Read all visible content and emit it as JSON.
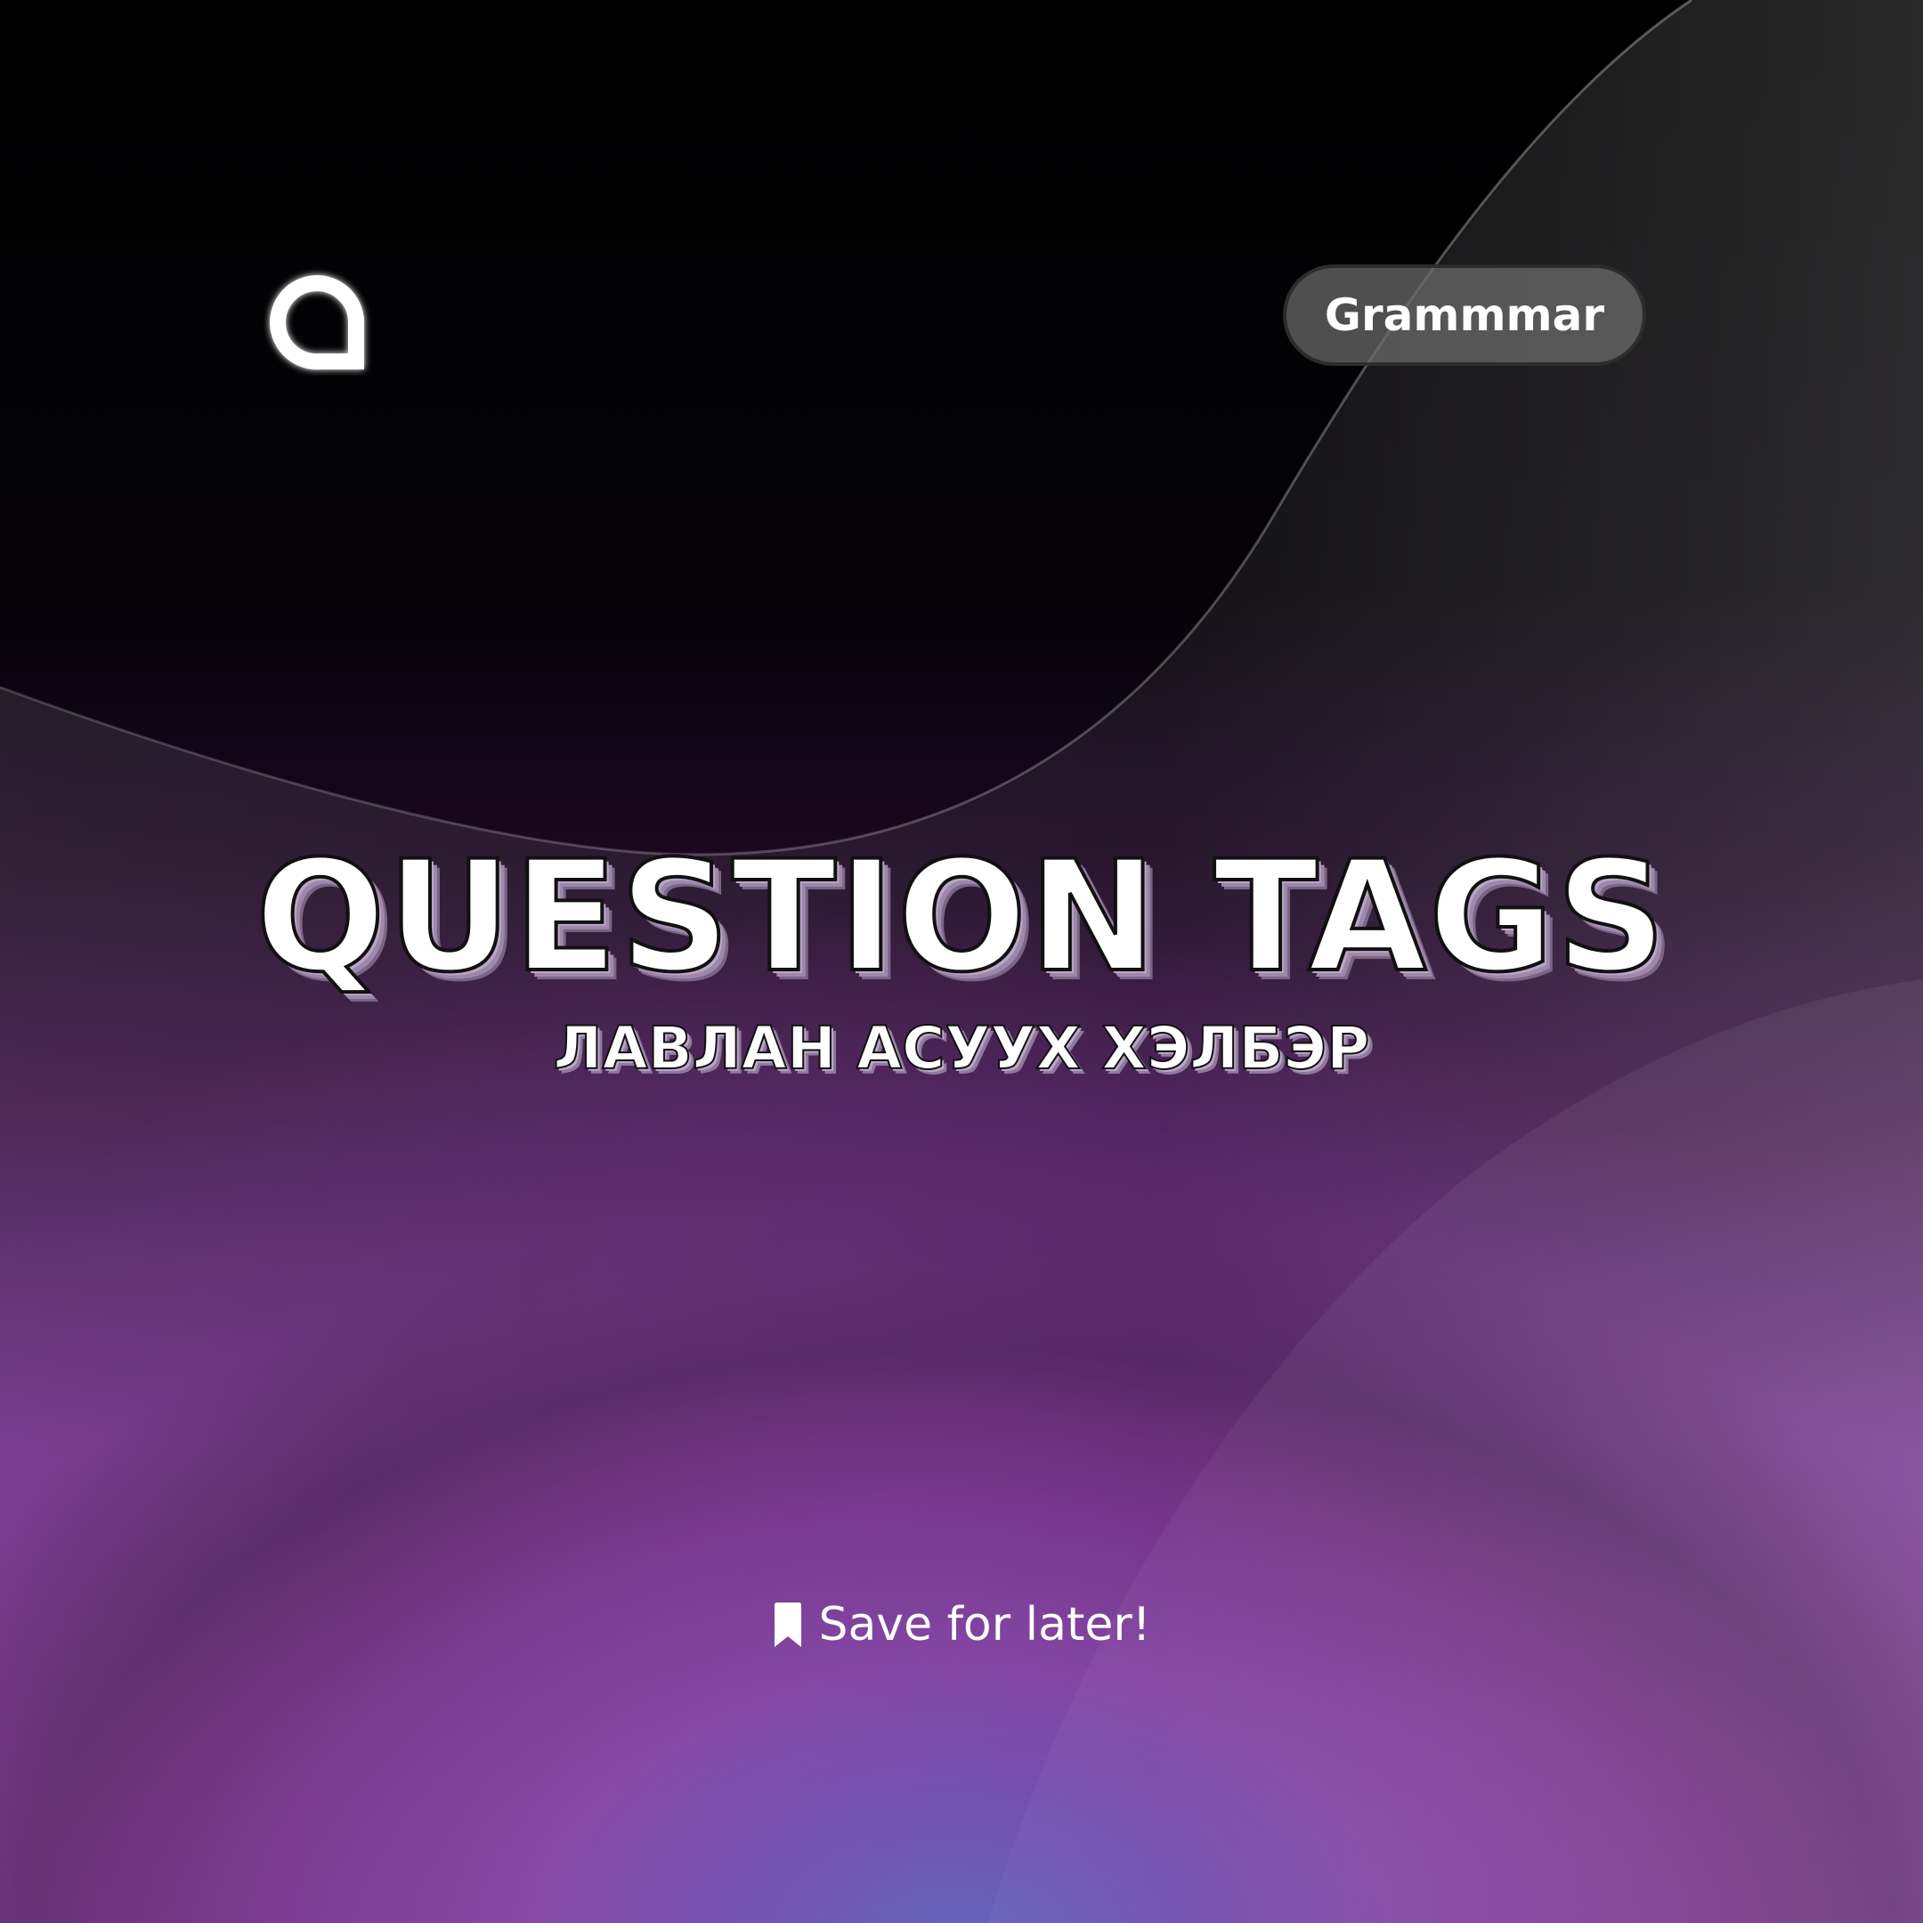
{
  "brand": {
    "logo_icon": "letter-a-logo-icon"
  },
  "category_tag": {
    "label": "Grammmar"
  },
  "headline": {
    "title": "QUESTION TAGS",
    "subtitle": "ЛАВЛАН АСУУХ ХЭЛБЭР"
  },
  "cta": {
    "icon": "bookmark-icon",
    "label": "Save for later!"
  },
  "colors": {
    "text": "#ffffff",
    "background_top": "#000000",
    "background_bottom": "#7e2a98",
    "accent_glow": "#5a5ab8"
  }
}
